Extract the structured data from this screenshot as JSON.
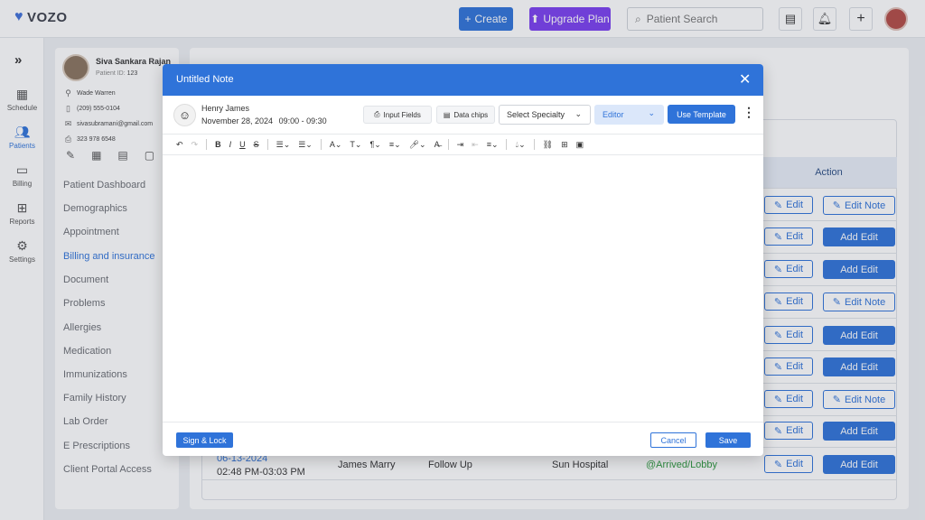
{
  "app": {
    "logo": "VOZO",
    "logo_icon": "heart-logo-icon"
  },
  "topbar": {
    "create_label": "Create",
    "upgrade_label": "Upgrade Plan",
    "search_placeholder": "Patient Search",
    "icons": [
      "chat-icon",
      "bell-icon",
      "plus-icon",
      "user-avatar"
    ]
  },
  "rail": {
    "items": [
      {
        "label": "Schedule",
        "icon": "calendar-icon"
      },
      {
        "label": "Patients",
        "icon": "users-icon"
      },
      {
        "label": "Billing",
        "icon": "wallet-icon"
      },
      {
        "label": "Reports",
        "icon": "report-icon"
      },
      {
        "label": "Settings",
        "icon": "gear-icon"
      }
    ],
    "active": "Patients"
  },
  "patient": {
    "name": "Siva Sankara Rajan",
    "id_label": "Patient ID:",
    "id_value": "123",
    "provider": "Wade Warren",
    "phone": "(209) 555-0104",
    "email": "sivasubramani@gmail.com",
    "fax": "323 978 6548",
    "menu": [
      "Patient Dashboard",
      "Demographics",
      "Appointment",
      "Billing and insurance",
      "Document",
      "Problems",
      "Allergies",
      "Medication",
      "Immunizations",
      "Family History",
      "Lab Order",
      "E Prescriptions",
      "Client Portal Access"
    ],
    "active_menu": "Billing and insurance"
  },
  "table": {
    "action_header": "Action",
    "edit_label": "Edit",
    "row_actions": [
      "Edit Note",
      "Add Edit",
      "Add Edit",
      "Edit Note",
      "Add Edit",
      "Add Edit",
      "Edit Note",
      "Add Edit",
      "Add Edit"
    ],
    "last_row": {
      "date": "06-13-2024",
      "time": "02:48 PM-03:03 PM",
      "provider": "James Marry",
      "visit_type": "Follow Up",
      "location": "Sun Hospital",
      "status": "@Arrived/Lobby"
    }
  },
  "modal": {
    "title": "Untitled Note",
    "provider_name": "Henry James",
    "date": "November 28, 2024",
    "time": "09:00 - 09:30",
    "input_fields_label": "Input Fields",
    "data_chips_label": "Data chips",
    "specialty_value": "Select Specialty",
    "mode_value": "Editor",
    "use_template_label": "Use Template",
    "sign_lock_label": "Sign & Lock",
    "cancel_label": "Cancel",
    "save_label": "Save"
  },
  "colors": {
    "primary": "#2f73d9",
    "upgrade": "#7a3ff0",
    "status_green": "#2e9a3e"
  }
}
